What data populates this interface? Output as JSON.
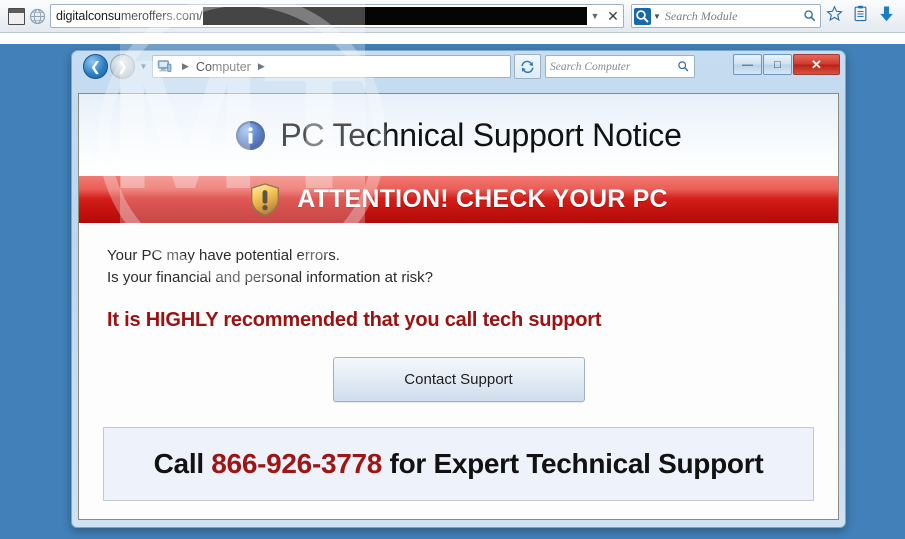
{
  "browser": {
    "favicon_icon": "favicon-placeholder-icon",
    "site_icon": "globe-icon",
    "url_text": "digitalconsumeroffers.com/",
    "url_redacted_note": "",
    "dropdown_icon": "chevron-down-icon",
    "stop_icon": "close-icon",
    "search_provider_icon": "search-provider-icon",
    "search_provider_caret": "chevron-down-icon",
    "search_placeholder": "Search Module",
    "search_icon": "search-icon",
    "bookmark_icon": "star-icon",
    "reading_list_icon": "clipboard-icon",
    "download_icon": "download-arrow-icon"
  },
  "explorer": {
    "back_icon": "back-arrow-icon",
    "forward_icon": "forward-arrow-icon",
    "history_caret_icon": "chevron-down-icon",
    "computer_icon": "computer-icon",
    "breadcrumb": "Computer",
    "breadcrumb_sep_icon": "chevron-right-icon",
    "breadcrumb_trailing_sep_icon": "chevron-right-icon",
    "refresh_icon": "refresh-icon",
    "search_placeholder": "Search Computer",
    "search_icon": "search-icon",
    "minimize_label": "—",
    "maximize_label": "□",
    "close_label": "✕"
  },
  "notice": {
    "info_icon": "info-circle-icon",
    "title": "PC Technical Support Notice",
    "shield_icon": "warning-shield-icon",
    "alert_text": "ATTENTION! CHECK YOUR PC",
    "line1": "Your PC may have potential errors.",
    "line2": "Is your financial and personal information at risk?",
    "recommendation": "It is HIGHLY recommended that you call tech support",
    "contact_button": "Contact Support",
    "call_prefix": "Call ",
    "phone_number": "866-926-3778",
    "call_suffix": " for Expert Technical Support"
  },
  "watermark": {
    "text": "MT"
  },
  "colors": {
    "desktop": "#4180b8",
    "alert_red_top": "#f07a72",
    "alert_red_bottom": "#b20a08",
    "recommend_red": "#9c1111",
    "phone_red": "#9e1515",
    "browser_accent": "#1868ae"
  }
}
